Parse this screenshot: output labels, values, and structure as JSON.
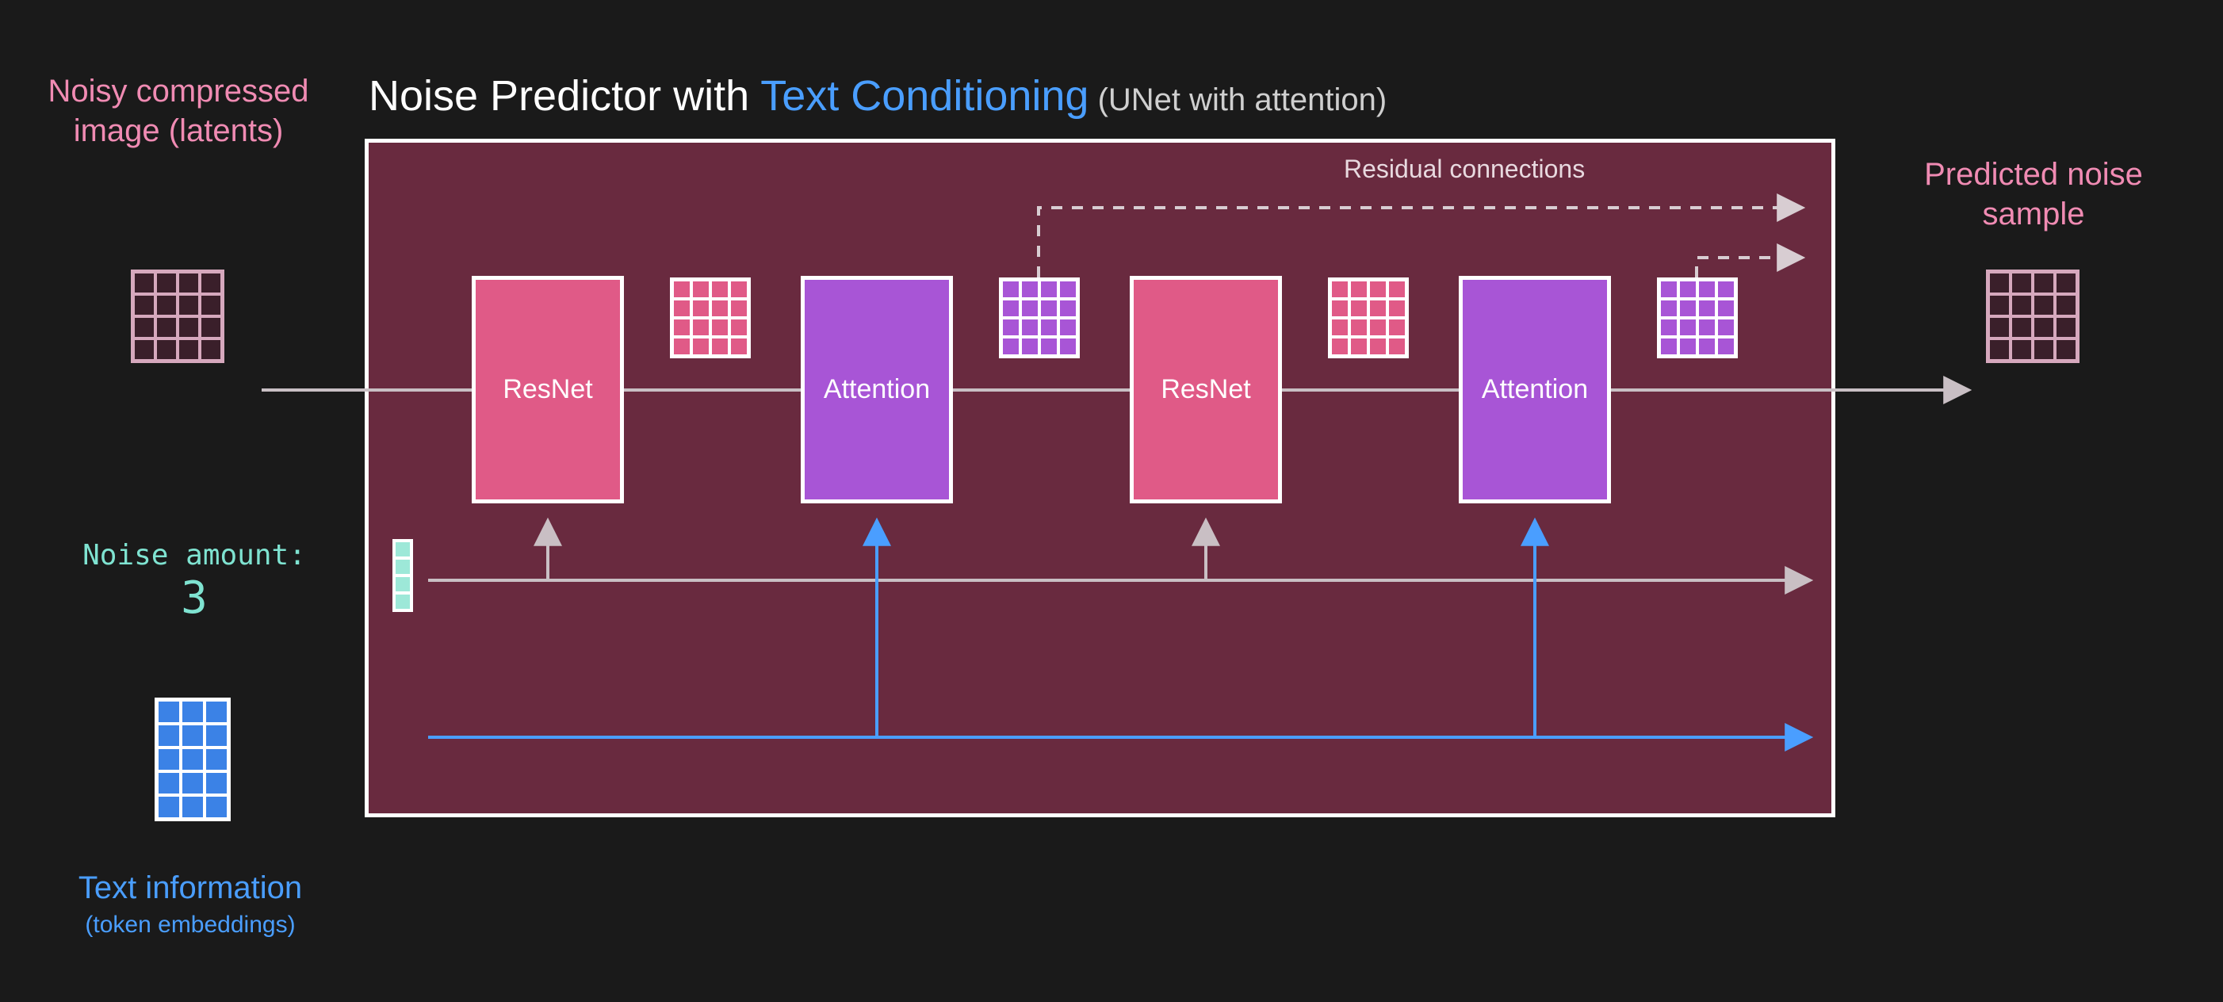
{
  "title": {
    "part1": "Noise Predictor with ",
    "part2": "Text Conditioning",
    "sub_prefix": " (UNet with ",
    "sub_accent": "attention",
    "sub_suffix": ")"
  },
  "inputs": {
    "latents_label": "Noisy compressed image (latents)",
    "noise_label": "Noise amount:",
    "noise_value": "3",
    "text_label": "Text information",
    "text_sub": "(token embeddings)"
  },
  "output_label": "Predicted noise sample",
  "residual_label": "Residual connections",
  "blocks": [
    {
      "type": "resnet",
      "label": "ResNet"
    },
    {
      "type": "attention",
      "label": "Attention"
    },
    {
      "type": "resnet",
      "label": "ResNet"
    },
    {
      "type": "attention",
      "label": "Attention"
    }
  ],
  "colors": {
    "pink": "#f08bb3",
    "blue": "#4a9eff",
    "purple": "#c77dff",
    "teal": "#7fe3d1",
    "resnet_fill": "#e05a87",
    "attention_fill": "#a855d6",
    "panel_fill": "rgba(128,48,74,0.78)",
    "dark_grid": "#d6a8bd",
    "dark_grid_fill": "#3a1f2a"
  },
  "grids": {
    "latents": {
      "rows": 4,
      "cols": 4,
      "cell": 28,
      "stroke": "#d6a8bd",
      "fill": "#3a1f2a"
    },
    "minipink": {
      "rows": 4,
      "cols": 4,
      "cell": 24,
      "stroke": "#ffffff",
      "fill": "#e05a87"
    },
    "minipurple": {
      "rows": 4,
      "cols": 4,
      "cell": 24,
      "stroke": "#ffffff",
      "fill": "#a855d6"
    },
    "output": {
      "rows": 4,
      "cols": 4,
      "cell": 28,
      "stroke": "#d6a8bd",
      "fill": "#3a1f2a"
    },
    "text": {
      "rows": 5,
      "cols": 3,
      "cell": 30,
      "stroke": "#ffffff",
      "fill": "#3b82e6"
    }
  }
}
